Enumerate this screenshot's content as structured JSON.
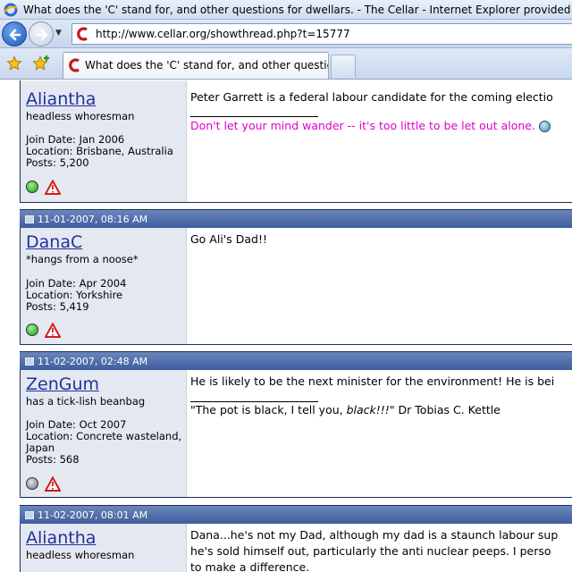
{
  "window": {
    "title": "What does the 'C' stand for, and other questions for dwellars. - The Cellar - Internet Explorer provided by Dell"
  },
  "addressbar": {
    "url": "http://www.cellar.org/showthread.php?t=15777"
  },
  "tabs": [
    {
      "label": "What does the 'C' stand for, and other questions ..."
    }
  ],
  "posts": [
    {
      "date": "",
      "username": "Aliantha",
      "usertitle": "headless whoresman",
      "join_date": "Join Date: Jan 2006",
      "location": "Location: Brisbane, Australia",
      "posts": "Posts: 5,200",
      "status": "online",
      "message_lines": [
        "Peter Garrett is a federal labour candidate for the coming electio"
      ],
      "signature": "Don't let your mind wander -- it's too little to be let out alone."
    },
    {
      "date": "11-01-2007, 08:16 AM",
      "username": "DanaC",
      "usertitle": "*hangs from a noose*",
      "join_date": "Join Date: Apr 2004",
      "location": "Location: Yorkshire",
      "posts": "Posts: 5,419",
      "status": "online",
      "message_lines": [
        "Go Ali's Dad!!"
      ]
    },
    {
      "date": "11-02-2007, 02:48 AM",
      "username": "ZenGum",
      "usertitle": "has a tick-lish beanbag",
      "join_date": "Join Date: Oct 2007",
      "location_line1": "Location: Concrete wasteland,",
      "location_line2": "Japan",
      "posts": "Posts: 568",
      "status": "offline",
      "message_lines": [
        "He is likely to be the next minister for the environment! He is bei"
      ],
      "signature_pre": "\"The pot is black, I tell you, ",
      "signature_italic": "black!!!",
      "signature_post": "\" Dr Tobias C. Kettle"
    },
    {
      "date": "11-02-2007, 08:01 AM",
      "username": "Aliantha",
      "usertitle": "headless whoresman",
      "message_lines": [
        "Dana...he's not my Dad, although my dad is a staunch labour sup",
        "he's sold himself out, particularly the anti nuclear peeps. I perso",
        "to make a difference."
      ]
    }
  ],
  "colors": {
    "post_header": "#3d5d9d",
    "userinfo_bg": "#e4e8f1",
    "username_link": "#22329a",
    "signature_pink": "#e000d0"
  },
  "icons": [
    "ie-logo-icon",
    "back-arrow-icon",
    "forward-arrow-icon",
    "favorites-star-icon",
    "add-favorites-icon",
    "cellar-favicon-icon",
    "post-icon",
    "online-status-icon",
    "report-post-icon",
    "smiley-icon"
  ]
}
